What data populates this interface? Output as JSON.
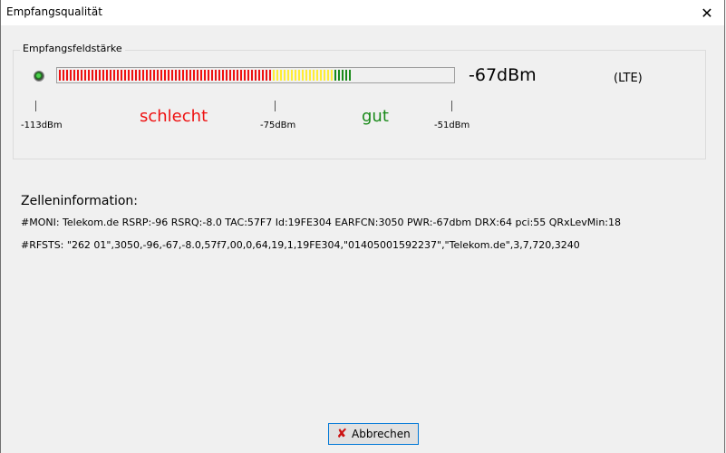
{
  "window": {
    "title": "Empfangsqualität",
    "close_glyph": "✕"
  },
  "signal": {
    "group_label": "Empfangsfeldstärke",
    "value_text": "-67dBm",
    "technology": "(LTE)",
    "level_dbm": -67,
    "scale_min_dbm": -113,
    "scale_max_dbm": -51,
    "ticks": [
      "-113dBm",
      "-75dBm",
      "-51dBm"
    ],
    "bad_label": "schlecht",
    "good_label": "gut",
    "colors": {
      "bad": "#ee1111",
      "medium": "#ffee33",
      "good": "#1a8a1a"
    }
  },
  "cell_info": {
    "heading": "Zelleninformation:",
    "moni": "#MONI: Telekom.de RSRP:-96 RSRQ:-8.0 TAC:57F7 Id:19FE304 EARFCN:3050 PWR:-67dbm DRX:64 pci:55 QRxLevMin:18",
    "rfsts": "#RFSTS: \"262 01\",3050,-96,-67,-8.0,57f7,00,0,64,19,1,19FE304,\"01405001592237\",\"Telekom.de\",3,7,720,3240"
  },
  "buttons": {
    "cancel_label": "Abbrechen",
    "cancel_icon": "close-icon"
  }
}
